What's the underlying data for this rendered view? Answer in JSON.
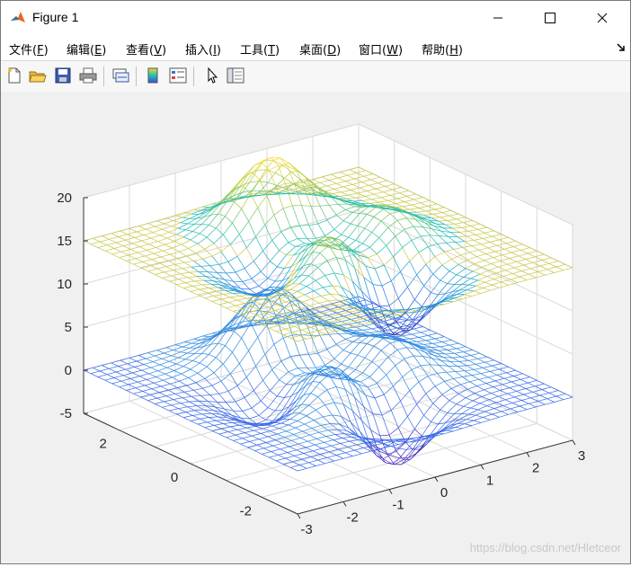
{
  "window": {
    "title": "Figure 1"
  },
  "menu": [
    {
      "pre": "文件(",
      "key": "F",
      "post": ")"
    },
    {
      "pre": "编辑(",
      "key": "E",
      "post": ")"
    },
    {
      "pre": "查看(",
      "key": "V",
      "post": ")"
    },
    {
      "pre": "插入(",
      "key": "I",
      "post": ")"
    },
    {
      "pre": "工具(",
      "key": "T",
      "post": ")"
    },
    {
      "pre": "桌面(",
      "key": "D",
      "post": ")"
    },
    {
      "pre": "窗口(",
      "key": "W",
      "post": ")"
    },
    {
      "pre": "帮助(",
      "key": "H",
      "post": ")"
    }
  ],
  "toolbar_icons": [
    "new-figure-icon",
    "open-file-icon",
    "save-icon",
    "print-icon",
    "link-plot-icon",
    "colorbar-icon",
    "legend-icon",
    "pointer-icon",
    "property-inspector-icon"
  ],
  "chart_data": {
    "type": "surface-mesh",
    "description_note": "",
    "series": [
      {
        "type": "mesh",
        "zoffset": 0
      },
      {
        "type": "mesh",
        "zoffset": 15
      }
    ],
    "xlim": [
      -3,
      3
    ],
    "ylim": [
      -3,
      3
    ],
    "zlim": [
      -5,
      20
    ],
    "xticks": [
      -3,
      -2,
      -1,
      0,
      1,
      2,
      3
    ],
    "yticks": [
      -2,
      0,
      2
    ],
    "zticks": [
      -5,
      0,
      5,
      10,
      15,
      20
    ],
    "grid": true,
    "colors": {
      "mesh_low": "#3a4fe0",
      "mesh_mid": "#22c0b0",
      "mesh_high": "#f7b82a",
      "flat_top": "#c8c84a",
      "grid": "#d9d9d9",
      "axes_bg": "#ffffff",
      "figure_bg": "#f0f0f0"
    }
  },
  "watermark": "https://blog.csdn.net/Hletceor"
}
